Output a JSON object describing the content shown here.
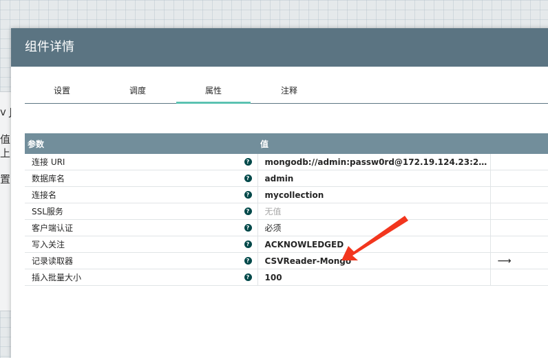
{
  "background": {
    "fragments": [
      "v J",
      "值",
      "上",
      "置"
    ]
  },
  "dialog": {
    "title": "组件详情",
    "tabs": [
      {
        "label": "设置",
        "active": false
      },
      {
        "label": "调度",
        "active": false
      },
      {
        "label": "属性",
        "active": true
      },
      {
        "label": "注释",
        "active": false
      }
    ]
  },
  "table": {
    "headers": {
      "param": "参数",
      "value": "值"
    },
    "rows": [
      {
        "name": "连接 URI",
        "value": "mongodb://admin:passw0rd@172.19.124.23:27017/?com...",
        "style": "bold",
        "action": ""
      },
      {
        "name": "数据库名",
        "value": "admin",
        "style": "bold",
        "action": ""
      },
      {
        "name": "连接名",
        "value": "mycollection",
        "style": "bold",
        "action": ""
      },
      {
        "name": "SSL服务",
        "value": "无值",
        "style": "muted",
        "action": ""
      },
      {
        "name": "客户端认证",
        "value": "必须",
        "style": "plain",
        "action": ""
      },
      {
        "name": "写入关注",
        "value": "ACKNOWLEDGED",
        "style": "bold",
        "action": ""
      },
      {
        "name": "记录读取器",
        "value": "CSVReader-Mongo",
        "style": "bold",
        "action": "⟶"
      },
      {
        "name": "插入批量大小",
        "value": "100",
        "style": "bold",
        "action": ""
      }
    ]
  },
  "colors": {
    "header_bg": "#5b7482",
    "table_header_bg": "#728e9b",
    "tab_active": "#5bc2b1",
    "annotation_arrow": "#f2361e"
  }
}
